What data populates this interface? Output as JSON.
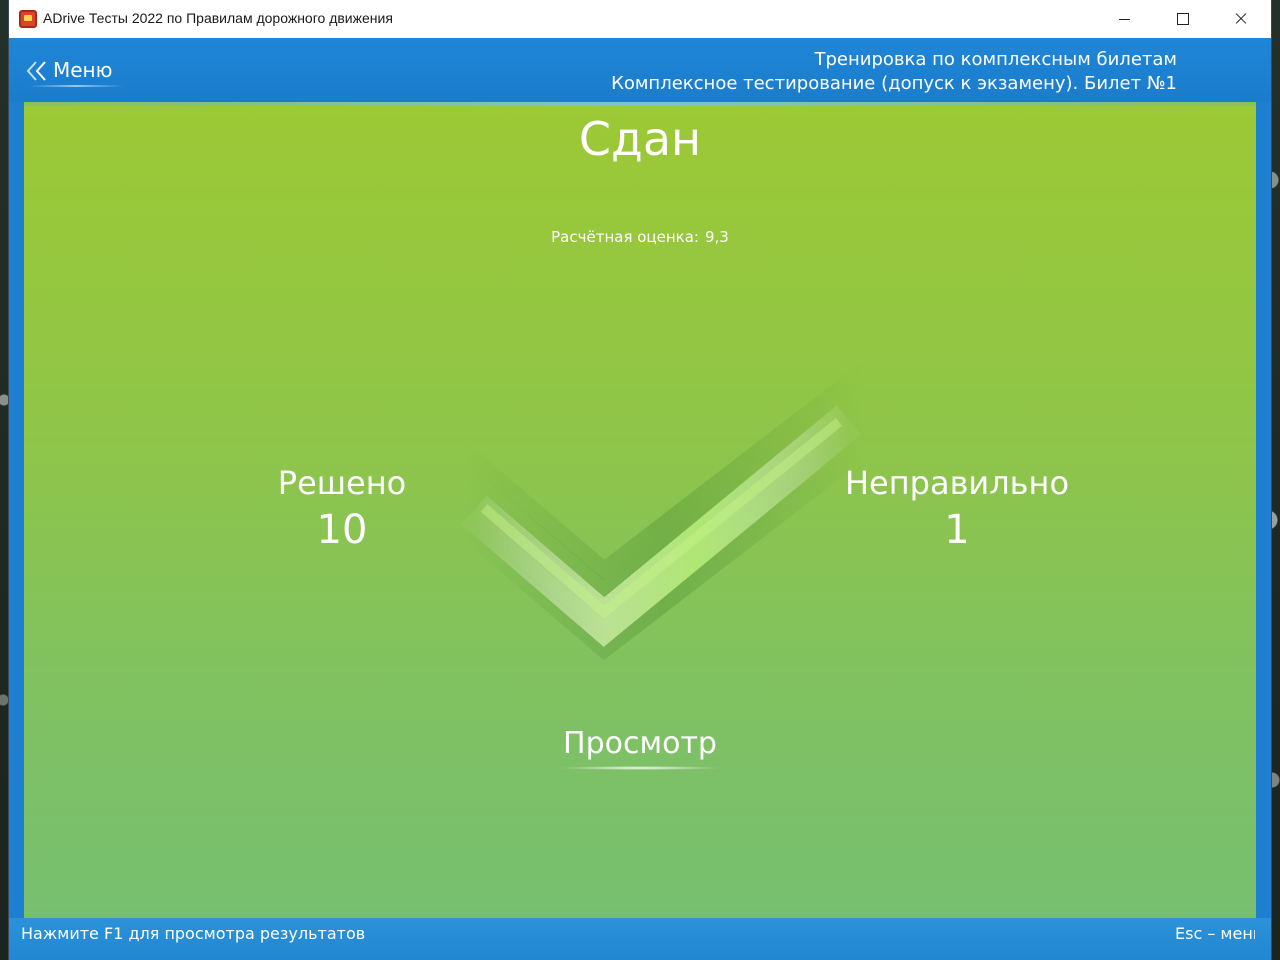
{
  "window": {
    "title": "ADrive Тесты 2022 по Правилам дорожного движения",
    "minimize_icon": "minimize-icon",
    "maximize_icon": "maximize-icon",
    "close_icon": "close-icon"
  },
  "header": {
    "menu_label": "Меню",
    "menu_icon": "double-chevron-left-icon",
    "line1": "Тренировка по комплексным билетам",
    "line2": "Комплексное тестирование (допуск к экзамену). Билет №1"
  },
  "result": {
    "status": "Сдан",
    "score_label": "Расчётная оценка:",
    "score_value": "9,3",
    "icon": "checkmark-icon",
    "solved_label": "Решено",
    "solved_value": "10",
    "wrong_label": "Неправильно",
    "wrong_value": "1",
    "review_label": "Просмотр"
  },
  "statusbar": {
    "left": "Нажмите F1 для просмотра результатов",
    "right": "Esc – меню"
  },
  "colors": {
    "accent_blue": "#1e7fd0",
    "content_green_top": "#9cc935",
    "content_green_bottom": "#77bf70"
  }
}
